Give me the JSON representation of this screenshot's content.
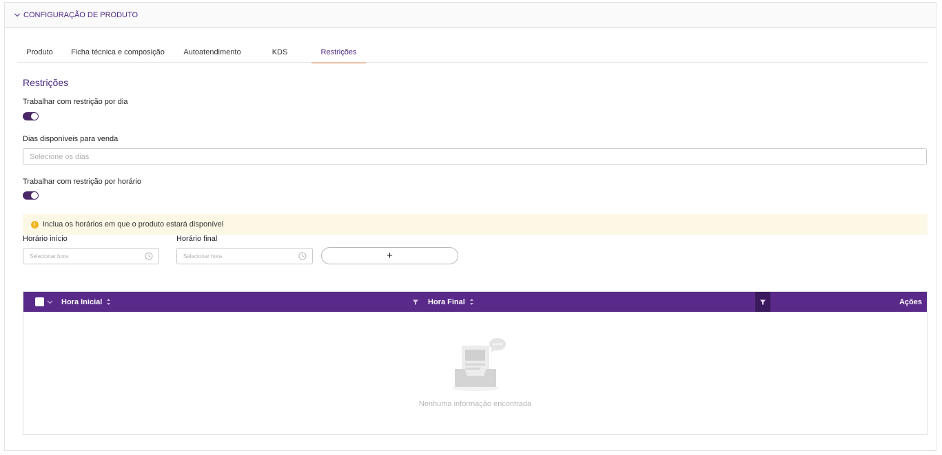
{
  "panel": {
    "title": "CONFIGURAÇÃO DE PRODUTO"
  },
  "tabs": [
    {
      "label": "Produto",
      "active": false
    },
    {
      "label": "Ficha técnica e composição",
      "active": false
    },
    {
      "label": "Autoatendimento",
      "active": false
    },
    {
      "label": "KDS",
      "active": false
    },
    {
      "label": "Restrições",
      "active": true
    }
  ],
  "restrictions": {
    "title": "Restrições",
    "day_toggle_label": "Trabalhar com restrição por dia",
    "day_toggle_on": true,
    "days_label": "Dias disponíveis para venda",
    "days_placeholder": "Selecione os dias",
    "time_toggle_label": "Trabalhar com restrição por horário",
    "time_toggle_on": true,
    "alert_text": "Inclua os horários em que o produto estará disponível",
    "start_label": "Horário início",
    "start_placeholder": "Selecionar hora",
    "end_label": "Horário final",
    "end_placeholder": "Selecionar hora",
    "add_label": "+"
  },
  "grid": {
    "columns": {
      "start": "Hora Inicial",
      "end": "Hora Final",
      "actions": "Ações"
    },
    "rows": [],
    "empty_text": "Nenhuma informação encontrada"
  },
  "colors": {
    "brand": "#5a2a8a",
    "brand_dark": "#3a1a5c",
    "tab_accent": "#e2742b",
    "alert_bg": "#fdf8e6",
    "warning": "#f0b41d"
  }
}
